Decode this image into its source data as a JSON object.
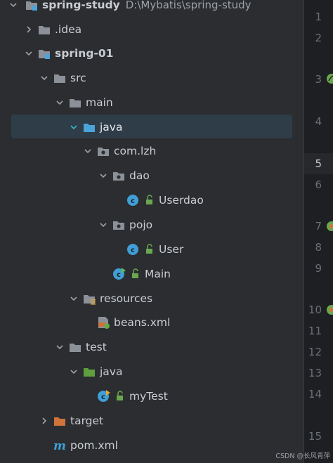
{
  "project": {
    "name": "spring-study",
    "path": "D:\\Mybatis\\spring-study"
  },
  "tree": {
    "idea": ".idea",
    "module": "spring-01",
    "src": "src",
    "main": "main",
    "java": "java",
    "package": "com.lzh",
    "dao": "dao",
    "userdao": "Userdao",
    "pojo": "pojo",
    "user": "User",
    "main_class": "Main",
    "resources": "resources",
    "beans": "beans.xml",
    "test": "test",
    "test_java": "java",
    "mytest": "myTest",
    "target": "target",
    "pom": "pom.xml"
  },
  "gutter": {
    "lines": [
      "1",
      "2",
      "3",
      "4",
      "5",
      "6",
      "7",
      "8",
      "9",
      "10",
      "11",
      "12",
      "13",
      "14",
      "15"
    ],
    "current_line": "5"
  },
  "watermark": "CSDN @长风青萍",
  "colors": {
    "selection": "#2f3d49",
    "folder": "#8c9199",
    "source_folder": "#4aa3d9",
    "test_folder": "#5f9f3f",
    "excluded_folder": "#d0733b",
    "class_icon": "#3f9fd6"
  }
}
